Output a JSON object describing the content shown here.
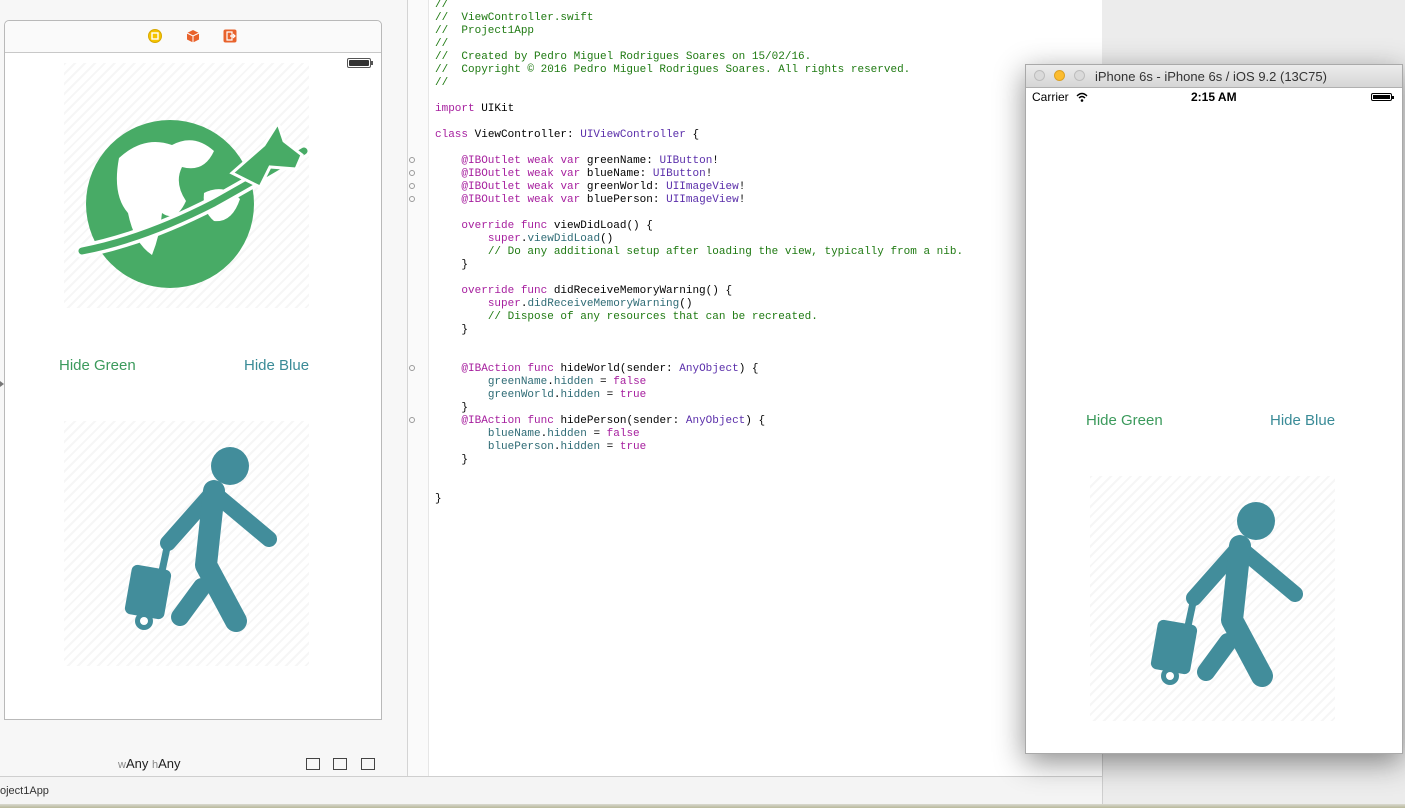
{
  "ib": {
    "buttons": {
      "hide_green": "Hide Green",
      "hide_blue": "Hide Blue"
    },
    "size_class": {
      "w_prefix": "w",
      "w_value": "Any",
      "h_prefix": "h",
      "h_value": "Any"
    },
    "icons": [
      "view-controller-icon",
      "first-responder-icon",
      "exit-icon"
    ],
    "colors": {
      "green": "#48ab66",
      "blue": "#428d9b"
    }
  },
  "editor": {
    "lines": [
      "//",
      "//  ViewController.swift",
      "//  Project1App",
      "//",
      "//  Created by Pedro Miguel Rodrigues Soares on 15/02/16.",
      "//  Copyright © 2016 Pedro Miguel Rodrigues Soares. All rights reserved.",
      "//",
      "",
      "import UIKit",
      "",
      "class ViewController: UIViewController {",
      "",
      "    @IBOutlet weak var greenName: UIButton!",
      "    @IBOutlet weak var blueName: UIButton!",
      "    @IBOutlet weak var greenWorld: UIImageView!",
      "    @IBOutlet weak var bluePerson: UIImageView!",
      "",
      "    override func viewDidLoad() {",
      "        super.viewDidLoad()",
      "        // Do any additional setup after loading the view, typically from a nib.",
      "    }",
      "",
      "    override func didReceiveMemoryWarning() {",
      "        super.didReceiveMemoryWarning()",
      "        // Dispose of any resources that can be recreated.",
      "    }",
      "",
      "",
      "    @IBAction func hideWorld(sender: AnyObject) {",
      "        greenName.hidden = false",
      "        greenWorld.hidden = true",
      "    }",
      "    @IBAction func hidePerson(sender: AnyObject) {",
      "        blueName.hidden = false",
      "        bluePerson.hidden = true",
      "    }",
      "",
      "",
      "}"
    ]
  },
  "statusbar": {
    "project": "oject1App"
  },
  "simulator": {
    "title": "iPhone 6s - iPhone 6s / iOS 9.2 (13C75)",
    "carrier": "Carrier",
    "time": "2:15 AM",
    "buttons": {
      "hide_green": "Hide Green",
      "hide_blue": "Hide Blue"
    }
  }
}
